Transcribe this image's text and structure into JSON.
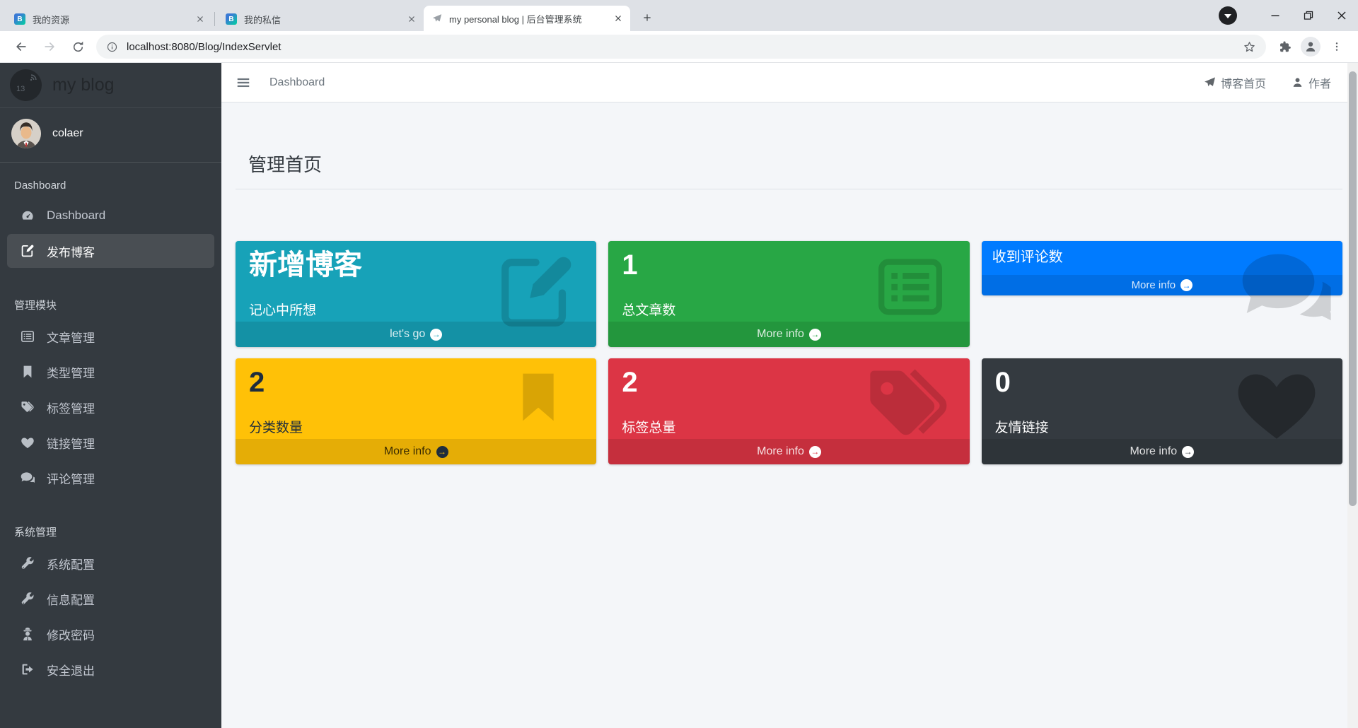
{
  "browser": {
    "tabs": [
      {
        "title": "我的资源",
        "favicon": "wb-logo-icon"
      },
      {
        "title": "我的私信",
        "favicon": "wb-logo-icon"
      },
      {
        "title": "my personal blog | 后台管理系统",
        "favicon": "blog-favicon-icon",
        "active": true
      }
    ],
    "url": "localhost:8080/Blog/IndexServlet"
  },
  "sidebar": {
    "brand": "my blog",
    "logo_text": "13",
    "user": "colaer",
    "groups": [
      {
        "label": "Dashboard",
        "items": [
          {
            "label": "Dashboard",
            "icon": "tachometer-icon"
          },
          {
            "label": "发布博客",
            "icon": "edit-icon",
            "active": true
          }
        ]
      },
      {
        "label": "管理模块",
        "items": [
          {
            "label": "文章管理",
            "icon": "list-icon"
          },
          {
            "label": "类型管理",
            "icon": "bookmark-icon"
          },
          {
            "label": "标签管理",
            "icon": "tags-icon"
          },
          {
            "label": "链接管理",
            "icon": "heart-icon"
          },
          {
            "label": "评论管理",
            "icon": "comments-icon"
          }
        ]
      },
      {
        "label": "系统管理",
        "items": [
          {
            "label": "系统配置",
            "icon": "wrench-icon"
          },
          {
            "label": "信息配置",
            "icon": "wrench-icon"
          },
          {
            "label": "修改密码",
            "icon": "user-secret-icon"
          },
          {
            "label": "安全退出",
            "icon": "sign-out-icon"
          }
        ]
      }
    ]
  },
  "navbar": {
    "breadcrumb": "Dashboard",
    "links": [
      {
        "label": "博客首页",
        "icon": "paper-plane-icon"
      },
      {
        "label": "作者",
        "icon": "user-icon"
      }
    ]
  },
  "content": {
    "heading": "管理首页",
    "boxes": [
      {
        "title": "新增博客",
        "subtitle": "记心中所想",
        "footer": "let's go",
        "color": "#17a2b8",
        "icon": "edit-icon"
      },
      {
        "title": "1",
        "subtitle": "总文章数",
        "footer": "More info",
        "color": "#28a745",
        "icon": "list-icon"
      },
      {
        "title": "收到评论数",
        "footer": "More info",
        "color": "#007bff",
        "icon": "comments-icon"
      },
      {
        "title": "2",
        "subtitle": "分类数量",
        "footer": "More info",
        "color": "#ffc107",
        "icon": "bookmark-icon"
      },
      {
        "title": "2",
        "subtitle": "标签总量",
        "footer": "More info",
        "color": "#dc3545",
        "icon": "tags-icon"
      },
      {
        "title": "0",
        "subtitle": "友情链接",
        "footer": "More info",
        "color": "#343a40",
        "icon": "heart-icon"
      }
    ]
  }
}
